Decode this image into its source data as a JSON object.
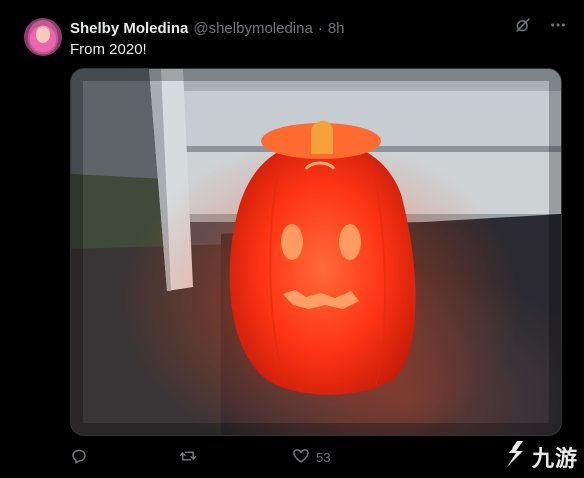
{
  "post": {
    "author_name": "Shelby Moledina",
    "author_handle": "@shelbymoledina",
    "separator": "·",
    "time": "8h",
    "text": "From 2020!",
    "like_count": "53"
  },
  "icons": {
    "grok": "grok-icon",
    "more": "more-icon",
    "reply": "reply-icon",
    "repost": "repost-icon",
    "like": "heart-icon"
  },
  "watermark": {
    "text": "九游",
    "logo": "jiuyou-logo"
  },
  "colors": {
    "background": "#000000",
    "primary_text": "#e7e9ea",
    "secondary_text": "#71767b",
    "pumpkin_glow": "#ff3b14"
  }
}
